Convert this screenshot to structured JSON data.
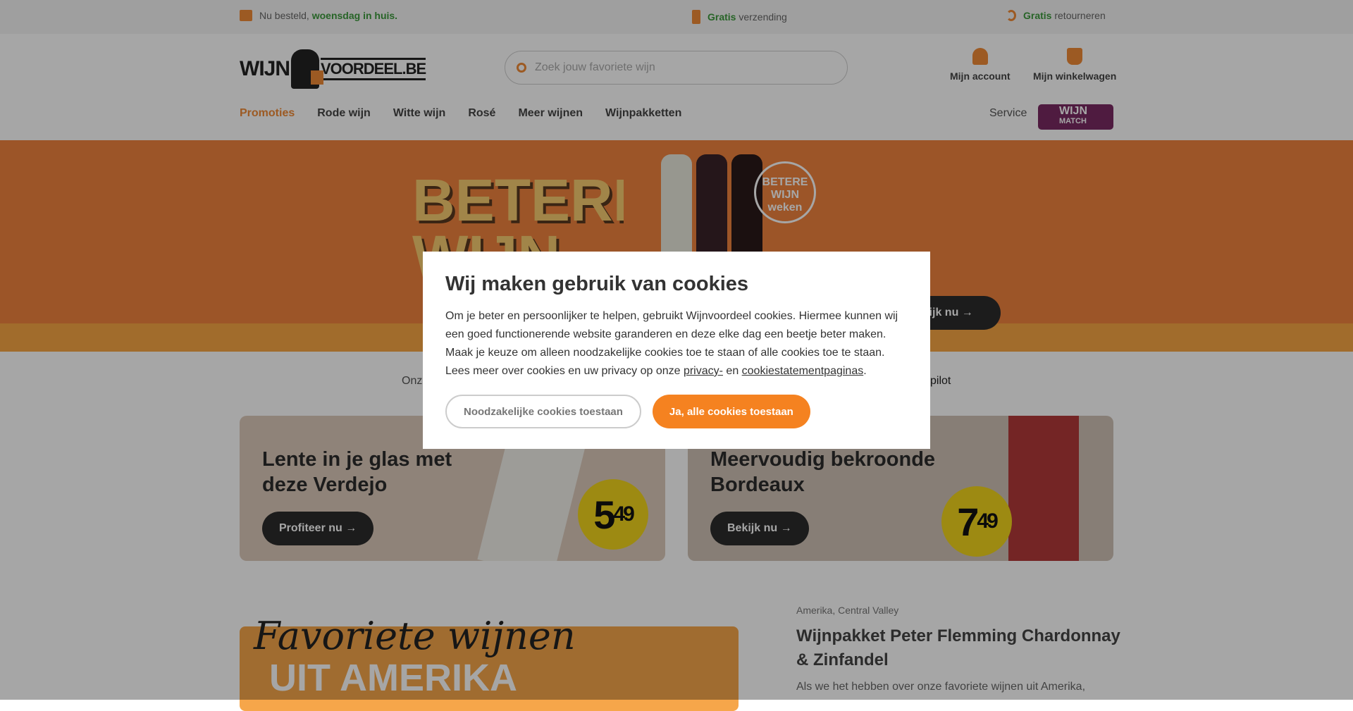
{
  "topbar": {
    "delivery_pre": "Nu besteld, ",
    "delivery_bold": "woensdag in huis.",
    "shipping_bold": "Gratis",
    "shipping": " verzending",
    "returns_bold": "Gratis",
    "returns": " retourneren"
  },
  "header": {
    "logo_left": "WIJN",
    "logo_right": "VOORDEEL.BE",
    "search_placeholder": "Zoek jouw favoriete wijn",
    "account": "Mijn account",
    "cart": "Mijn winkelwagen"
  },
  "nav": {
    "items": [
      "Promoties",
      "Rode wijn",
      "Witte wijn",
      "Rosé",
      "Meer wijnen",
      "Wijnpakketten"
    ],
    "service": "Service",
    "wijnmatch_1": "WIJN",
    "wijnmatch_2": "MATCH"
  },
  "hero": {
    "headline": "BETERE WIJN",
    "badge": "BETERE WIJN weken",
    "button": "Bekijk nu →"
  },
  "trust": {
    "left": "Onz",
    "right": "pilot"
  },
  "cards": [
    {
      "title": "Lente in je glas met deze Verdejo",
      "button": "Profiteer nu →",
      "price_main": "5",
      "price_cents": "49"
    },
    {
      "title": "Meervoudig bekroonde Bordeaux",
      "button": "Bekijk nu →",
      "price_main": "7",
      "price_cents": "49"
    }
  ],
  "promo": {
    "script": "Favoriete wijnen",
    "big": "UIT AMERIKA"
  },
  "product": {
    "region": "Amerika, Central Valley",
    "title": "Wijnpakket Peter Flemming Chardonnay & Zinfandel",
    "desc": "Als we het hebben over onze favoriete wijnen uit Amerika,"
  },
  "cookie": {
    "title": "Wij maken gebruik van cookies",
    "body": "Om je beter en persoonlijker te helpen, gebruikt Wijnvoordeel cookies. Hiermee kunnen wij een goed functionerende website garanderen en deze elke dag een beetje beter maken.  Maak je keuze om alleen noodzakelijke cookies toe te staan of alle cookies toe te staan.",
    "more_pre": "Lees meer over cookies en uw privacy op onze ",
    "privacy_link": "privacy-",
    "more_mid": " en ",
    "cookie_link": "cookiestatementpaginas",
    "more_post": ".",
    "btn_necessary": "Noodzakelijke cookies toestaan",
    "btn_all": "Ja, alle cookies toestaan"
  },
  "colors": {
    "accent": "#f58220",
    "green": "#3c9a3c",
    "wijnmatch": "#7a2a63",
    "price": "#f1d51d"
  }
}
